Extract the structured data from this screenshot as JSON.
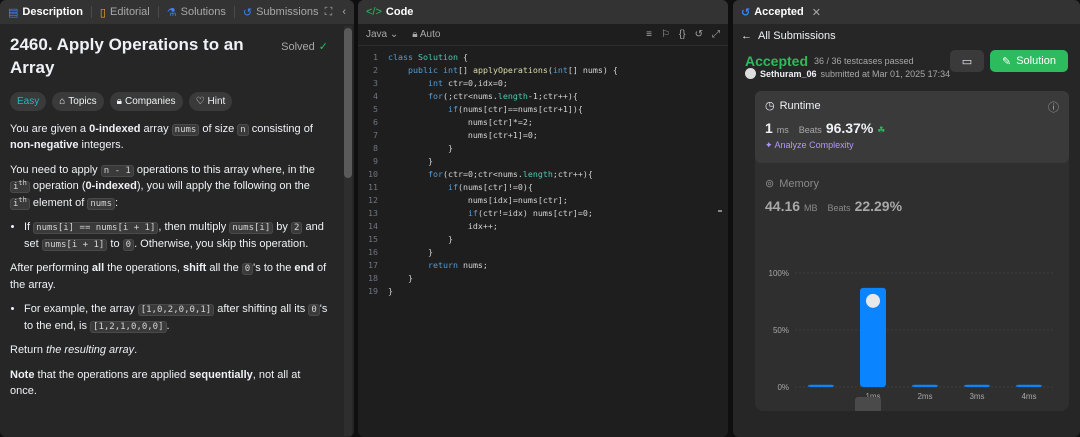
{
  "left": {
    "tabs": [
      {
        "label": "Description",
        "active": true
      },
      {
        "label": "Editorial"
      },
      {
        "label": "Solutions"
      },
      {
        "label": "Submissions"
      }
    ],
    "title": "2460. Apply Operations to an Array",
    "solved": "Solved",
    "tags": {
      "difficulty": "Easy",
      "topics": "Topics",
      "companies": "Companies",
      "hint": "Hint"
    },
    "p1": {
      "a": "You are given a ",
      "b": "0-indexed",
      "c": " array ",
      "code1": "nums",
      "d": " of size ",
      "code2": "n",
      "e": " consisting of ",
      "f": "non-negative",
      "g": " integers."
    },
    "p2": {
      "a": "You need to apply ",
      "code1": "n - 1",
      "b": " operations to this array where, in the ",
      "code2": "i",
      "sup": "th",
      "c": " operation (",
      "d": "0-indexed",
      "e": "), you will apply the following on the ",
      "code3": "i",
      "sup2": "th",
      "f": " element of ",
      "code4": "nums",
      "g": ":"
    },
    "b1": {
      "a": "If ",
      "code1": "nums[i] == nums[i + 1]",
      "b": ", then multiply ",
      "code2": "nums[i]",
      "c": " by ",
      "code3": "2",
      "d": " and set ",
      "code4": "nums[i + 1]",
      "e": " to ",
      "code5": "0",
      "f": ". Otherwise, you skip this operation."
    },
    "p3": {
      "a": "After performing ",
      "b": "all",
      "c": " the operations, ",
      "d": "shift",
      "e": " all the ",
      "code1": "0",
      "f": "'s to the ",
      "g": "end",
      "h": " of the array."
    },
    "b2": {
      "a": "For example, the array ",
      "code1": "[1,0,2,0,0,1]",
      "b": " after shifting all its ",
      "code2": "0",
      "c": "'s to the end, is ",
      "code3": "[1,2,1,0,0,0]",
      "d": "."
    },
    "p4": {
      "a": "Return ",
      "b": "the resulting array",
      "c": "."
    },
    "p5": {
      "a": "Note",
      "b": " that the operations are applied ",
      "c": "sequentially",
      "d": ", not all at once."
    }
  },
  "code": {
    "header": "Code",
    "language": "Java",
    "mode": "Auto",
    "lines": [
      "class Solution {",
      "    public int[] applyOperations(int[] nums) {",
      "        int ctr=0,idx=0;",
      "        for(;ctr<nums.length-1;ctr++){",
      "            if(nums[ctr]==nums[ctr+1]){",
      "                nums[ctr]*=2;",
      "                nums[ctr+1]=0;",
      "            }",
      "        }",
      "        for(ctr=0;ctr<nums.length;ctr++){",
      "            if(nums[ctr]!=0){",
      "                nums[idx]=nums[ctr];",
      "                if(ctr!=idx) nums[ctr]=0;",
      "                idx++;",
      "            }",
      "        }",
      "        return nums;",
      "    }",
      "}"
    ]
  },
  "right": {
    "tab": "Accepted",
    "back": "All Submissions",
    "status": "Accepted",
    "passed": "36 / 36 testcases passed",
    "user": "Sethuram_06",
    "submitted": "submitted at Mar 01, 2025 17:34",
    "solution_btn": "Solution",
    "runtime": {
      "title": "Runtime",
      "value": "1",
      "unit": "ms",
      "beats_label": "Beats",
      "beats": "96.37%",
      "analyze": "Analyze Complexity"
    },
    "memory": {
      "title": "Memory",
      "value": "44.16",
      "unit": "MB",
      "beats_label": "Beats",
      "beats": "22.29%"
    }
  },
  "chart_data": {
    "type": "bar",
    "categories": [
      "",
      "1ms",
      "2ms",
      "3ms",
      "4ms"
    ],
    "values": [
      2,
      87,
      2,
      2,
      2
    ],
    "yticks": [
      "100%",
      "50%",
      "0%"
    ],
    "ylim": [
      0,
      100
    ],
    "highlight_index": 1,
    "bar_color": "#0a84ff"
  }
}
